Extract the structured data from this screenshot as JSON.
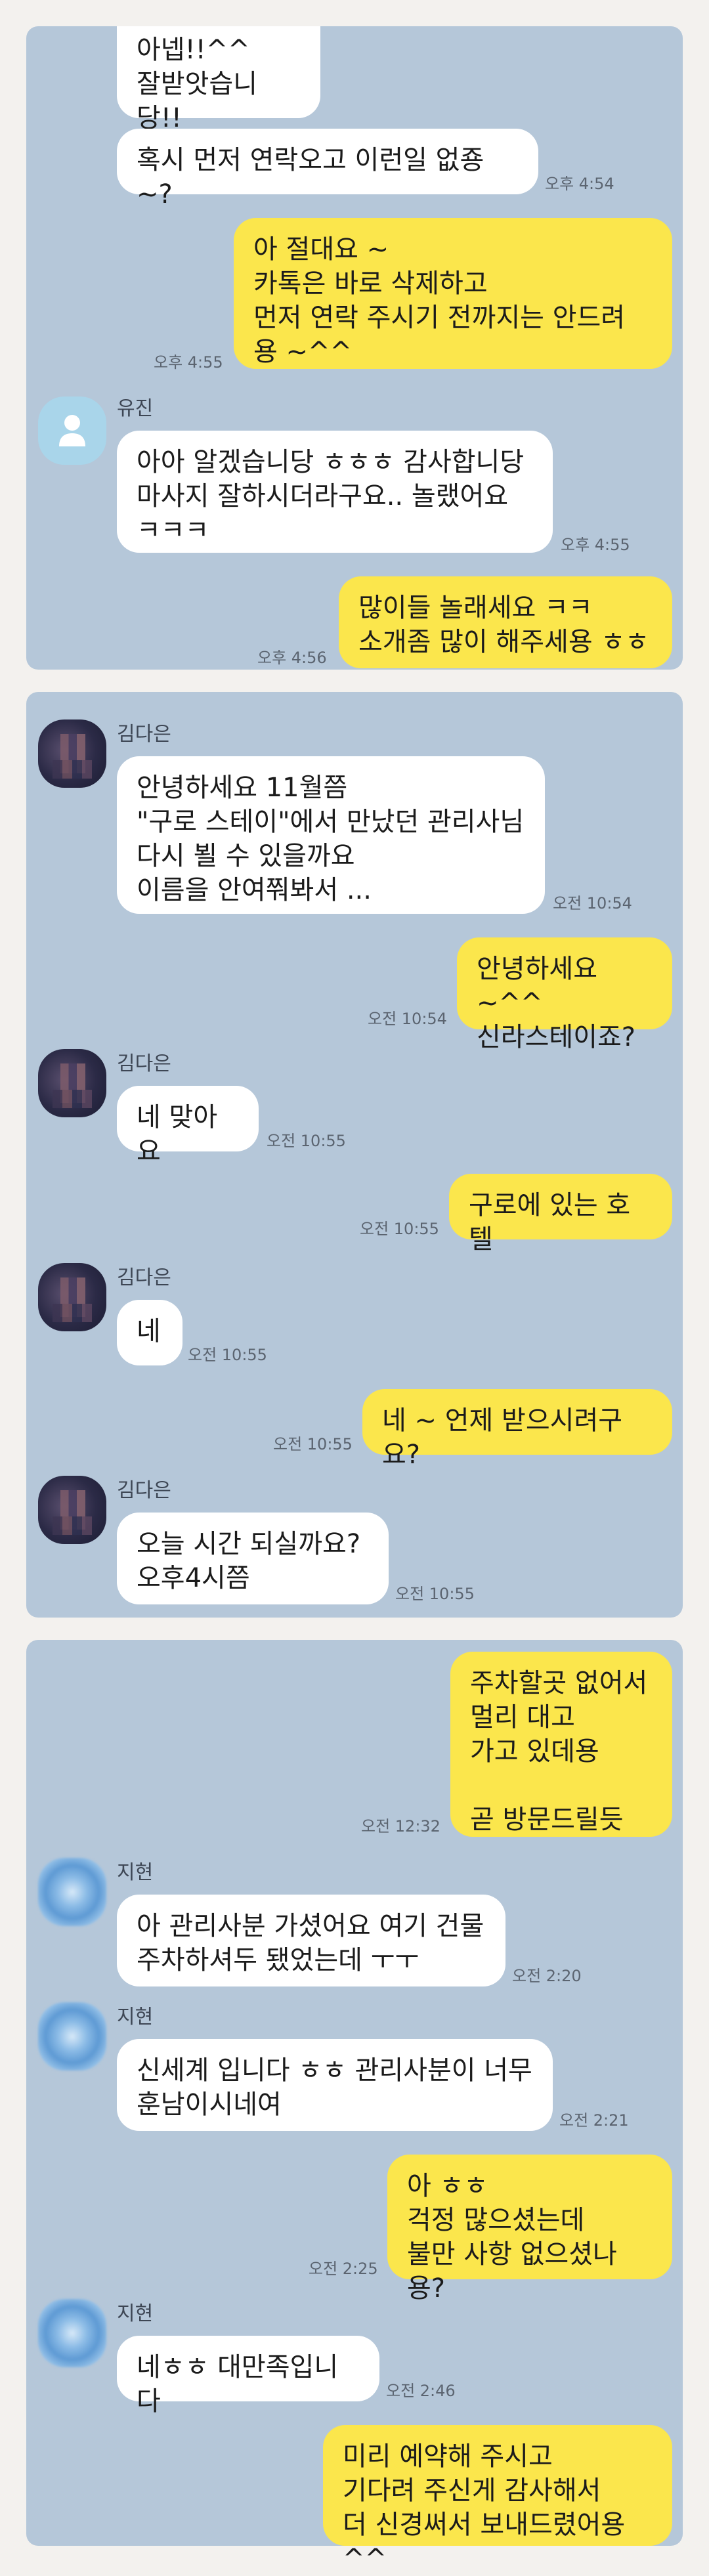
{
  "colors": {
    "chat_bg": "#b5c7d9",
    "page_bg": "#f3f1ee",
    "incoming": "#ffffff",
    "outgoing": "#fbe64c"
  },
  "section1": {
    "m1": {
      "text": "아넵!!^^\n잘받앗습니당!!"
    },
    "m2": {
      "text": "혹시 먼저 연락오고 이런일 없죵~?",
      "time": "오후 4:54"
    },
    "m3": {
      "text": "아 절대요 ~\n카톡은 바로 삭제하고\n먼저 연락 주시기 전까지는 안드려\n용 ~^^",
      "time": "오후 4:55"
    },
    "sender": "유진",
    "m4": {
      "text": "아아 알겠습니당 ㅎㅎㅎ 감사합니당\n마사지 잘하시더라구요.. 놀랬어요\nㅋㅋㅋ",
      "time": "오후 4:55"
    },
    "m5": {
      "text": "많이들 놀래세요 ㅋㅋ\n소개좀 많이 해주세용 ㅎㅎ",
      "time": "오후 4:56"
    }
  },
  "section2": {
    "sender": "김다은",
    "m1": {
      "text": "안녕하세요 11월쯤\n\"구로 스테이\"에서 만났던 관리사님\n다시 뵐 수 있을까요\n이름을 안여쭤봐서 ...",
      "time": "오전 10:54"
    },
    "m2": {
      "text": "안녕하세요 ~^^\n신라스테이죠?",
      "time": "오전 10:54"
    },
    "m3": {
      "text": "네 맞아요",
      "time": "오전 10:55"
    },
    "m4": {
      "text": "구로에 있는 호텔",
      "time": "오전 10:55"
    },
    "m5": {
      "text": "네",
      "time": "오전 10:55"
    },
    "m6": {
      "text": "네 ~ 언제 받으시려구요?",
      "time": "오전 10:55"
    },
    "m7": {
      "text": "오늘  시간 되실까요?\n오후4시쯤",
      "time": "오전 10:55"
    }
  },
  "section3": {
    "sender": "지현",
    "m1": {
      "text": "주차할곳 없어서\n멀리 대고\n가고 있데용\n\n곧 방문드릴듯",
      "time": "오전 12:32"
    },
    "m2": {
      "text": "아 관리사분 가셨어요 여기 건물\n주차하셔두 됐었는데 ㅜㅜ",
      "time": "오전 2:20"
    },
    "m3": {
      "text": "신세계 입니다 ㅎㅎ 관리사분이 너무\n훈남이시네여",
      "time": "오전 2:21"
    },
    "m4": {
      "text": "아 ㅎㅎ\n걱정 많으셨는데\n불만 사항 없으셨나용?",
      "time": "오전 2:25"
    },
    "m5": {
      "text": "네ㅎㅎ 대만족입니다",
      "time": "오전 2:46"
    },
    "m6": {
      "text": "미리 예약해 주시고\n기다려 주신게 감사해서\n더 신경써서 보내드렸어용 ^^"
    }
  }
}
